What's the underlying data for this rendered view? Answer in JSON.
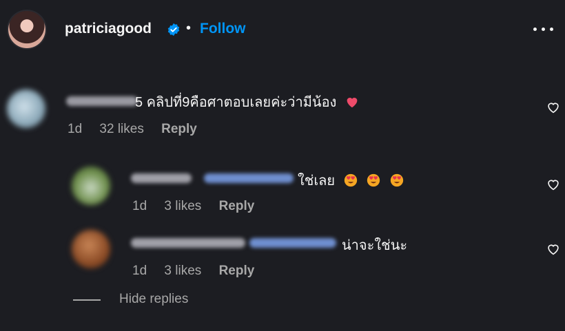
{
  "header": {
    "username": "patriciagood",
    "separator": "•",
    "follow_label": "Follow"
  },
  "comments": [
    {
      "username_blurred": "mai_bb2545",
      "text_suffix": "5 คลิปที่9คือศาตอบเลยค่ะว่ามีน้อง",
      "time": "1d",
      "likes": "32 likes",
      "reply_label": "Reply"
    }
  ],
  "replies": [
    {
      "username_blurred": "User00kak",
      "mention_blurred": "@mai_bb2545",
      "text": "ใช่เลย",
      "time": "1d",
      "likes": "3 likes",
      "reply_label": "Reply"
    },
    {
      "username_blurred": "nickname_0804489",
      "mention_blurred": "@mai_bb2545",
      "text": "น่าจะใช่นะ",
      "time": "1d",
      "likes": "3 likes",
      "reply_label": "Reply"
    }
  ],
  "hide_replies_label": "Hide replies",
  "colors": {
    "background": "#1c1d22",
    "follow": "#0095f6",
    "verified": "#0095f6",
    "meta": "#a8a8a8",
    "heart_emoji": "#ee4b6a"
  },
  "icons": [
    "verified-badge-icon",
    "more-options-icon",
    "heart-outline-icon",
    "heart-emoji-icon",
    "heart-eyes-emoji-icon"
  ]
}
